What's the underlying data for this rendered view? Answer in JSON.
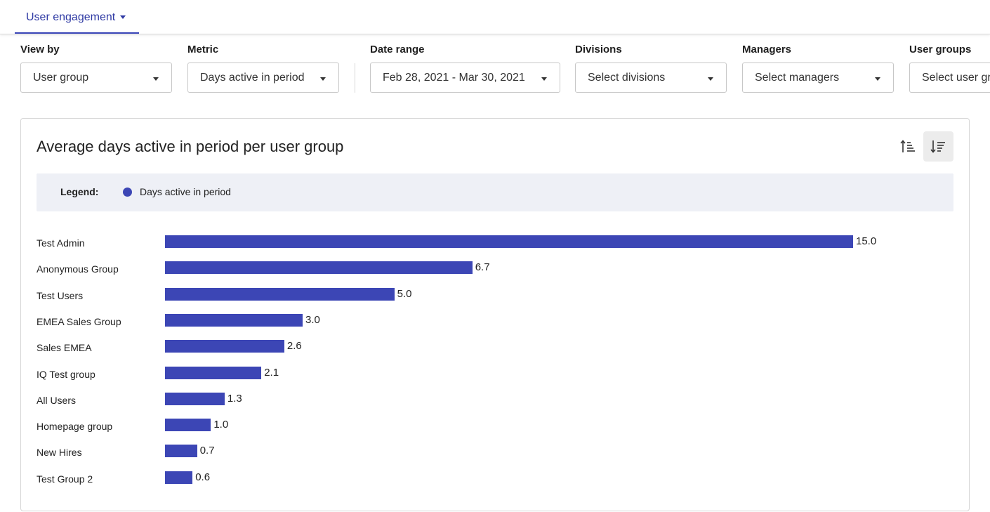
{
  "tabs": {
    "active_label": "User engagement"
  },
  "filters": {
    "view_by": {
      "label": "View by",
      "value": "User group"
    },
    "metric": {
      "label": "Metric",
      "value": "Days active in period"
    },
    "date_range": {
      "label": "Date range",
      "value": "Feb 28, 2021 - Mar 30, 2021"
    },
    "divisions": {
      "label": "Divisions",
      "placeholder": "Select divisions"
    },
    "managers": {
      "label": "Managers",
      "placeholder": "Select managers"
    },
    "user_groups": {
      "label": "User groups",
      "placeholder": "Select user gr"
    }
  },
  "card": {
    "title": "Average days active in period per user group",
    "sort_buttons": {
      "ascending_icon": "sort-ascending-icon",
      "descending_icon": "sort-descending-icon",
      "active": "descending"
    },
    "legend": {
      "title": "Legend:",
      "items": [
        {
          "label": "Days active in period",
          "color": "#3c46b5"
        }
      ]
    }
  },
  "chart_data": {
    "type": "bar",
    "orientation": "horizontal",
    "title": "Average days active in period per user group",
    "categories": [
      "Test Admin",
      "Anonymous Group",
      "Test Users",
      "EMEA Sales Group",
      "Sales EMEA",
      "IQ Test group",
      "All Users",
      "Homepage group",
      "New Hires",
      "Test Group 2"
    ],
    "series": [
      {
        "name": "Days active in period",
        "color": "#3c46b5",
        "values": [
          15.0,
          6.7,
          5.0,
          3.0,
          2.6,
          2.1,
          1.3,
          1.0,
          0.7,
          0.6
        ],
        "labels": [
          "15.0",
          "6.7",
          "5.0",
          "3.0",
          "2.6",
          "2.1",
          "1.3",
          "1.0",
          "0.7",
          "0.6"
        ]
      }
    ],
    "xlim": [
      0,
      15.0
    ],
    "grid": false,
    "legend_position": "top"
  }
}
